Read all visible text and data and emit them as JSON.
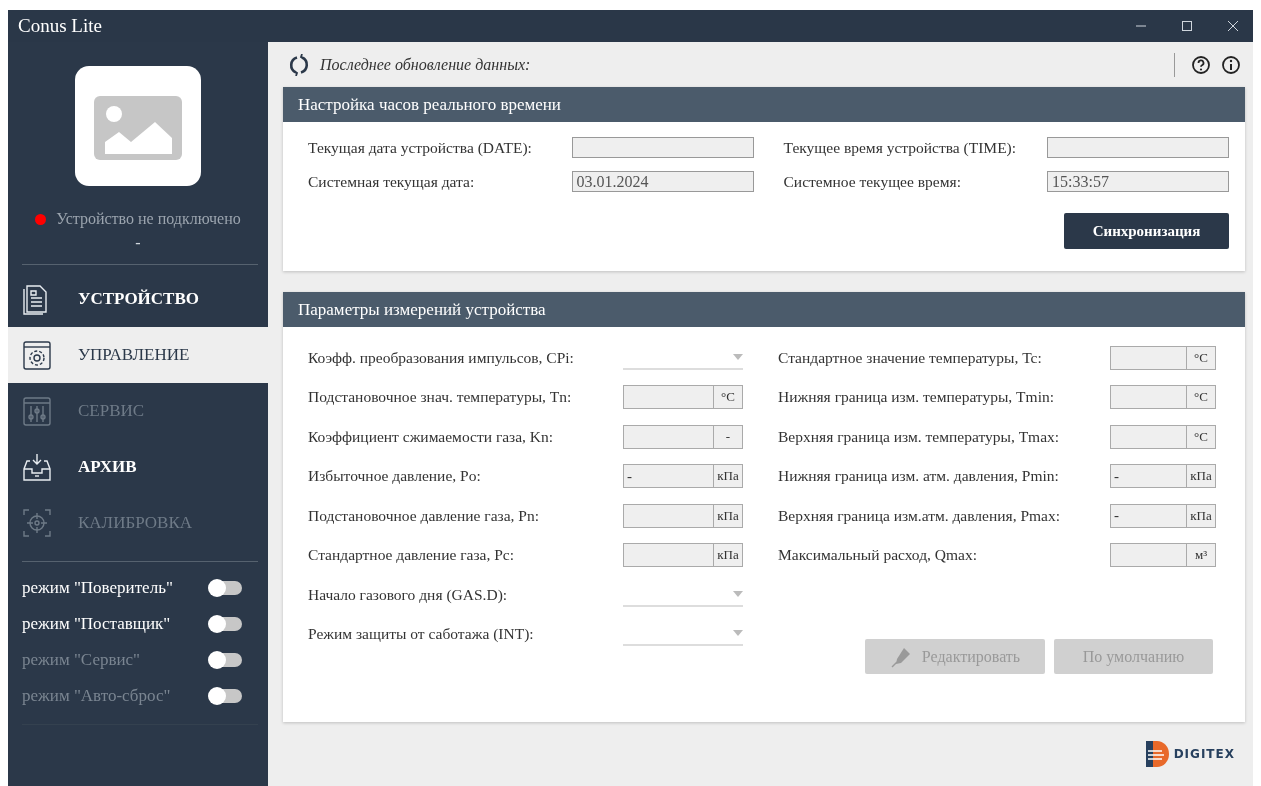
{
  "window": {
    "title": "Conus Lite"
  },
  "sidebar": {
    "device": {
      "status": "Устройство не подключено",
      "connected": false,
      "serial": "-"
    },
    "nav": [
      {
        "label": "УСТРОЙСТВО",
        "kind": "document",
        "selected": false,
        "disabled": false
      },
      {
        "label": "УПРАВЛЕНИЕ",
        "kind": "gear",
        "selected": true,
        "disabled": false
      },
      {
        "label": "СЕРВИС",
        "kind": "sliders",
        "selected": false,
        "disabled": true
      },
      {
        "label": "АРХИВ",
        "kind": "archive",
        "selected": false,
        "disabled": false
      },
      {
        "label": "КАЛИБРОВКА",
        "kind": "target",
        "selected": false,
        "disabled": true
      }
    ],
    "modes": [
      {
        "label": "режим \"Поверитель\"",
        "on": false,
        "disabled": false
      },
      {
        "label": "режим \"Поставщик\"",
        "on": false,
        "disabled": false
      },
      {
        "label": "режим \"Сервис\"",
        "on": false,
        "disabled": true
      },
      {
        "label": "режим \"Авто-сброс\"",
        "on": false,
        "disabled": true
      }
    ]
  },
  "toolbar": {
    "text": "Последнее обновление данных:"
  },
  "clock_panel": {
    "title": "Настройка часов реального времени",
    "fields": [
      {
        "label": "Текущая дата устройства (DATE):"
      },
      {
        "label": "Текущее время устройства (TIME):"
      },
      {
        "label": "Системная текущая дата:",
        "value": "03.01.2024"
      },
      {
        "label": "Системное текущее время:",
        "value": "15:33:57"
      }
    ],
    "button": "Синхронизация"
  },
  "params_panel": {
    "title": "Параметры измерений устройства",
    "left": [
      {
        "label": "Коэфф. преобразования импульсов, CPi:",
        "kind": "select"
      },
      {
        "label": "Подстановочное знач. температуры, Tn:",
        "kind": "unit",
        "unit": "°C"
      },
      {
        "label": "Коэффициент сжимаемости газа, Kn:",
        "kind": "unit",
        "unit": "-"
      },
      {
        "label": "Избыточное давление, Po:",
        "kind": "unit",
        "unit": "кПа",
        "value": "-"
      },
      {
        "label": "Подстановочное давление газа, Pn:",
        "kind": "unit",
        "unit": "кПа"
      },
      {
        "label": "Стандартное давление газа, Pc:",
        "kind": "unit",
        "unit": "кПа"
      },
      {
        "label": "Начало газового дня (GAS.D):",
        "kind": "select"
      },
      {
        "label": "Режим защиты от саботажа (INT):",
        "kind": "select"
      }
    ],
    "right": [
      {
        "label": "Стандартное значение температуры, Tc:",
        "kind": "unit",
        "unit": "°C"
      },
      {
        "label": "Нижняя граница изм. температуры, Tmin:",
        "kind": "unit",
        "unit": "°C"
      },
      {
        "label": "Верхняя граница изм. температуры, Tmax:",
        "kind": "unit",
        "unit": "°C"
      },
      {
        "label": "Нижняя граница изм. атм. давления, Pmin:",
        "kind": "unit",
        "unit": "кПа",
        "value": "-"
      },
      {
        "label": "Верхняя граница изм.атм. давления, Pmax:",
        "kind": "unit",
        "unit": "кПа",
        "value": "-"
      },
      {
        "label": "Максимальный расход, Qmax:",
        "kind": "unit",
        "unit": "м³"
      }
    ],
    "buttons": [
      {
        "label": "Редактировать",
        "kind": "edit",
        "disabled": true
      },
      {
        "label": "По умолчанию",
        "kind": "plain",
        "disabled": true
      }
    ]
  },
  "footer": {
    "brand": "DIGITEX"
  }
}
